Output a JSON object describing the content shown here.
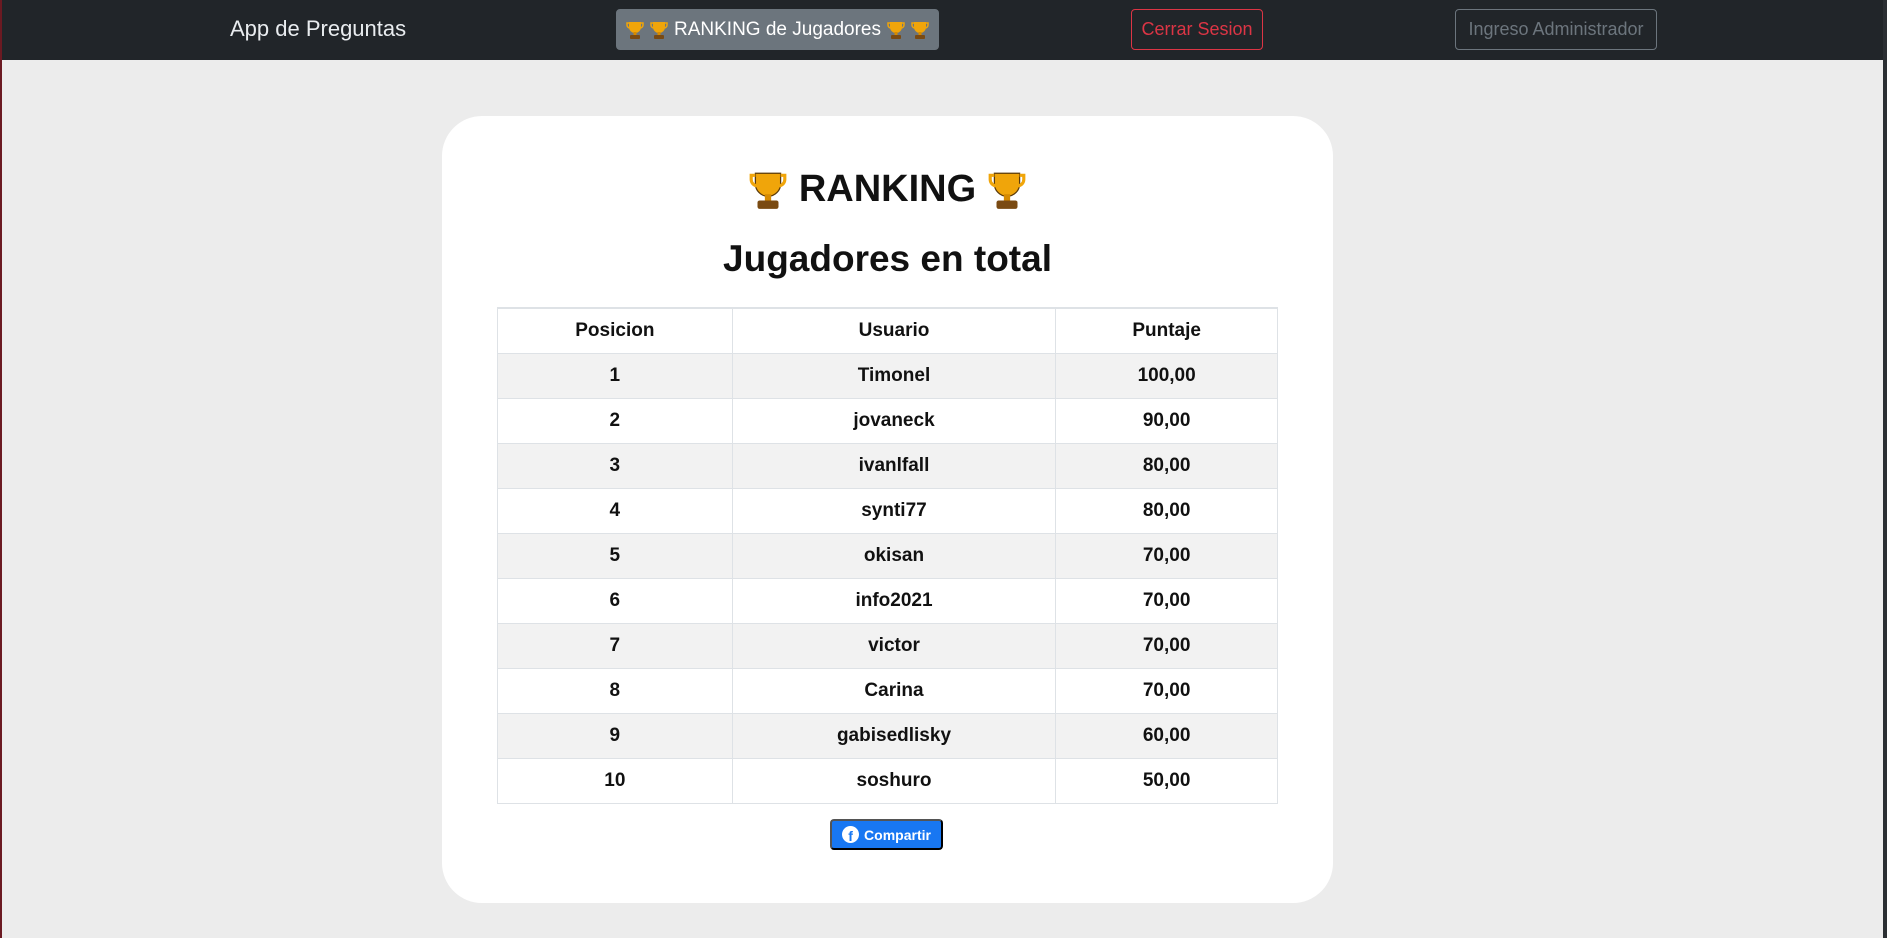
{
  "navbar": {
    "brand": "App de Preguntas",
    "ranking_button": "RANKING de Jugadores",
    "logout_button": "Cerrar Sesion",
    "admin_button": "Ingreso Administrador"
  },
  "card": {
    "title": "RANKING",
    "subtitle": "Jugadores en total",
    "share_button": "Compartir"
  },
  "table": {
    "headers": [
      "Posicion",
      "Usuario",
      "Puntaje"
    ],
    "rows": [
      [
        "1",
        "Timonel",
        "100,00"
      ],
      [
        "2",
        "jovaneck",
        "90,00"
      ],
      [
        "3",
        "ivanlfall",
        "80,00"
      ],
      [
        "4",
        "synti77",
        "80,00"
      ],
      [
        "5",
        "okisan",
        "70,00"
      ],
      [
        "6",
        "info2021",
        "70,00"
      ],
      [
        "7",
        "victor",
        "70,00"
      ],
      [
        "8",
        "Carina",
        "70,00"
      ],
      [
        "9",
        "gabisedlisky",
        "60,00"
      ],
      [
        "10",
        "soshuro",
        "50,00"
      ]
    ]
  },
  "colors": {
    "navbar_bg": "#212529",
    "danger": "#dc3545",
    "secondary": "#6c757d",
    "facebook": "#1877f2"
  },
  "icons": {
    "trophy": "trophy-icon",
    "facebook": "facebook-icon"
  }
}
